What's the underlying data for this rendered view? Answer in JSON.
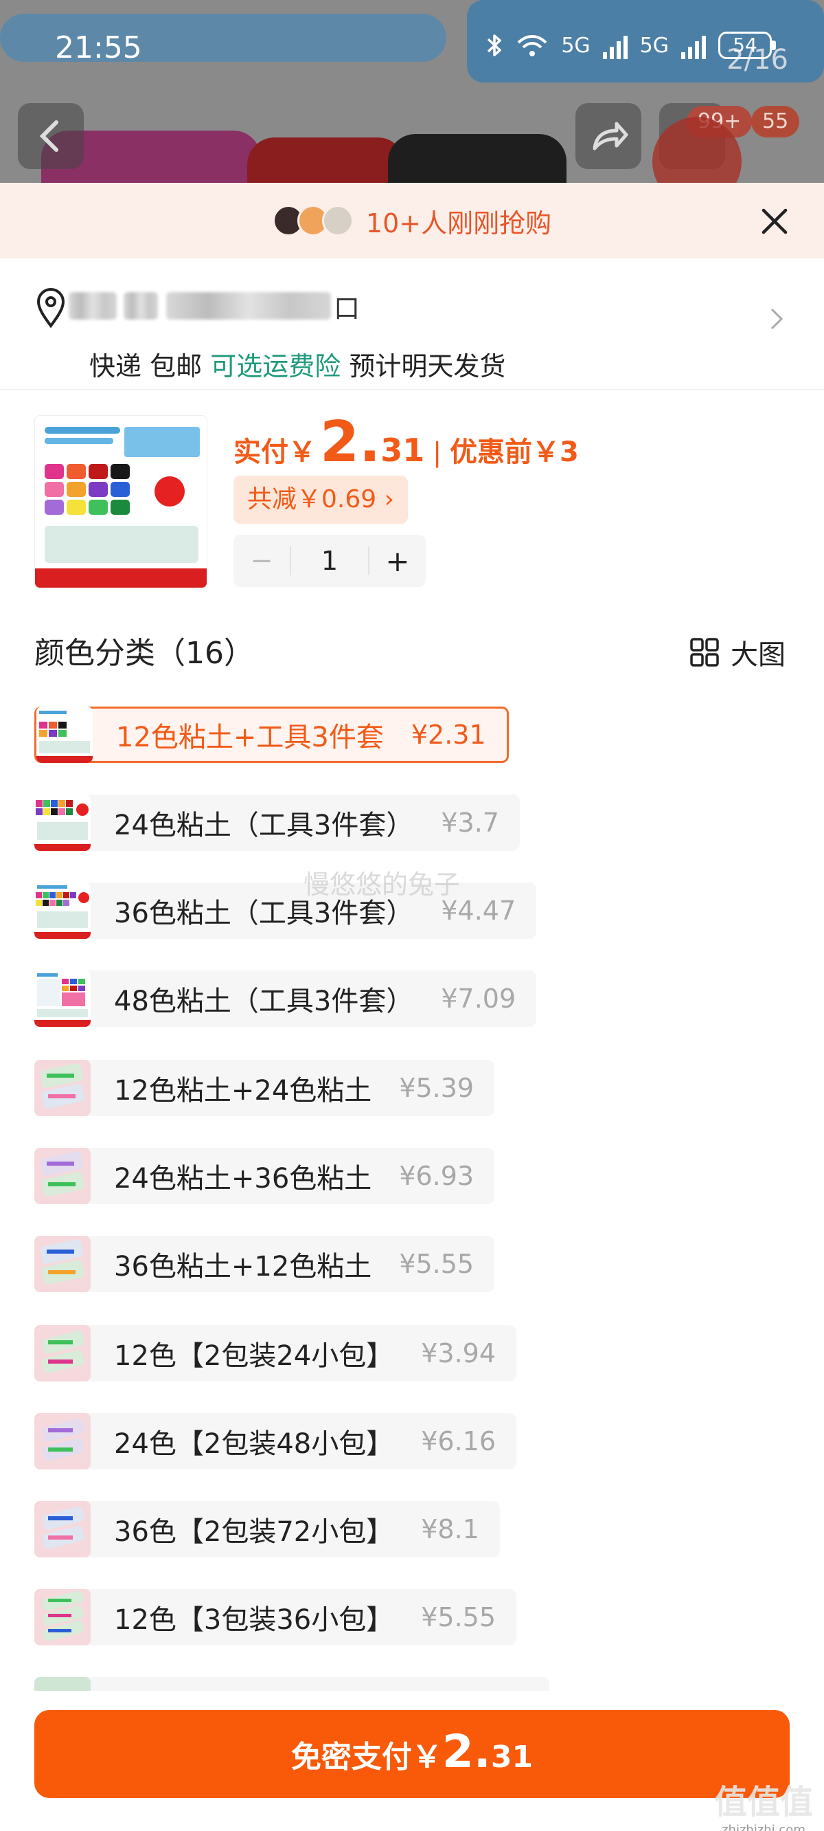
{
  "status_bar": {
    "time": "21:55",
    "signal_1": "5G",
    "signal_2": "5G",
    "battery": "54",
    "page_counter": "2/16"
  },
  "background": {
    "cart_badge": "99+",
    "other_badge": "55"
  },
  "banner": {
    "text": "10+人刚刚抢购",
    "accent_color": "#e8562a"
  },
  "address": {
    "tail": "口",
    "delivery_parts": {
      "method": "快递",
      "shipping": "包邮",
      "insurance": "可选运费险",
      "eta": "预计明天发货"
    }
  },
  "product": {
    "pay_label": "实付￥",
    "pay_int": "2.",
    "pay_dec": "31",
    "separator": "|",
    "pre_price": "优惠前￥3",
    "discount": "共减￥0.69 ›",
    "quantity": "1",
    "minus": "−",
    "plus": "+"
  },
  "section": {
    "title": "颜色分类（16）",
    "big_view": "大图"
  },
  "options": [
    {
      "label": "12色粘土+工具3件套",
      "price": "¥2.31",
      "selected": true
    },
    {
      "label": "24色粘土（工具3件套）",
      "price": "¥3.7"
    },
    {
      "label": "36色粘土（工具3件套）",
      "price": "¥4.47"
    },
    {
      "label": "48色粘土（工具3件套）",
      "price": "¥7.09"
    },
    {
      "label": "12色粘土+24色粘土",
      "price": "¥5.39"
    },
    {
      "label": "24色粘土+36色粘土",
      "price": "¥6.93"
    },
    {
      "label": "36色粘土+12色粘土",
      "price": "¥5.55"
    },
    {
      "label": "12色【2包装24小包】",
      "price": "¥3.94"
    },
    {
      "label": "24色【2包装48小包】",
      "price": "¥6.16"
    },
    {
      "label": "36色【2包装72小包】",
      "price": "¥8.1"
    },
    {
      "label": "12色【3包装36小包】",
      "price": "¥5.55"
    }
  ],
  "watermark": "慢悠悠的兔子",
  "pay_button": {
    "prefix": "免密支付￥",
    "int": "2.",
    "dec": "31",
    "color": "#f85a0a"
  },
  "site_mark": {
    "logo": "值值值",
    "url": "zhizhizhi.com"
  }
}
